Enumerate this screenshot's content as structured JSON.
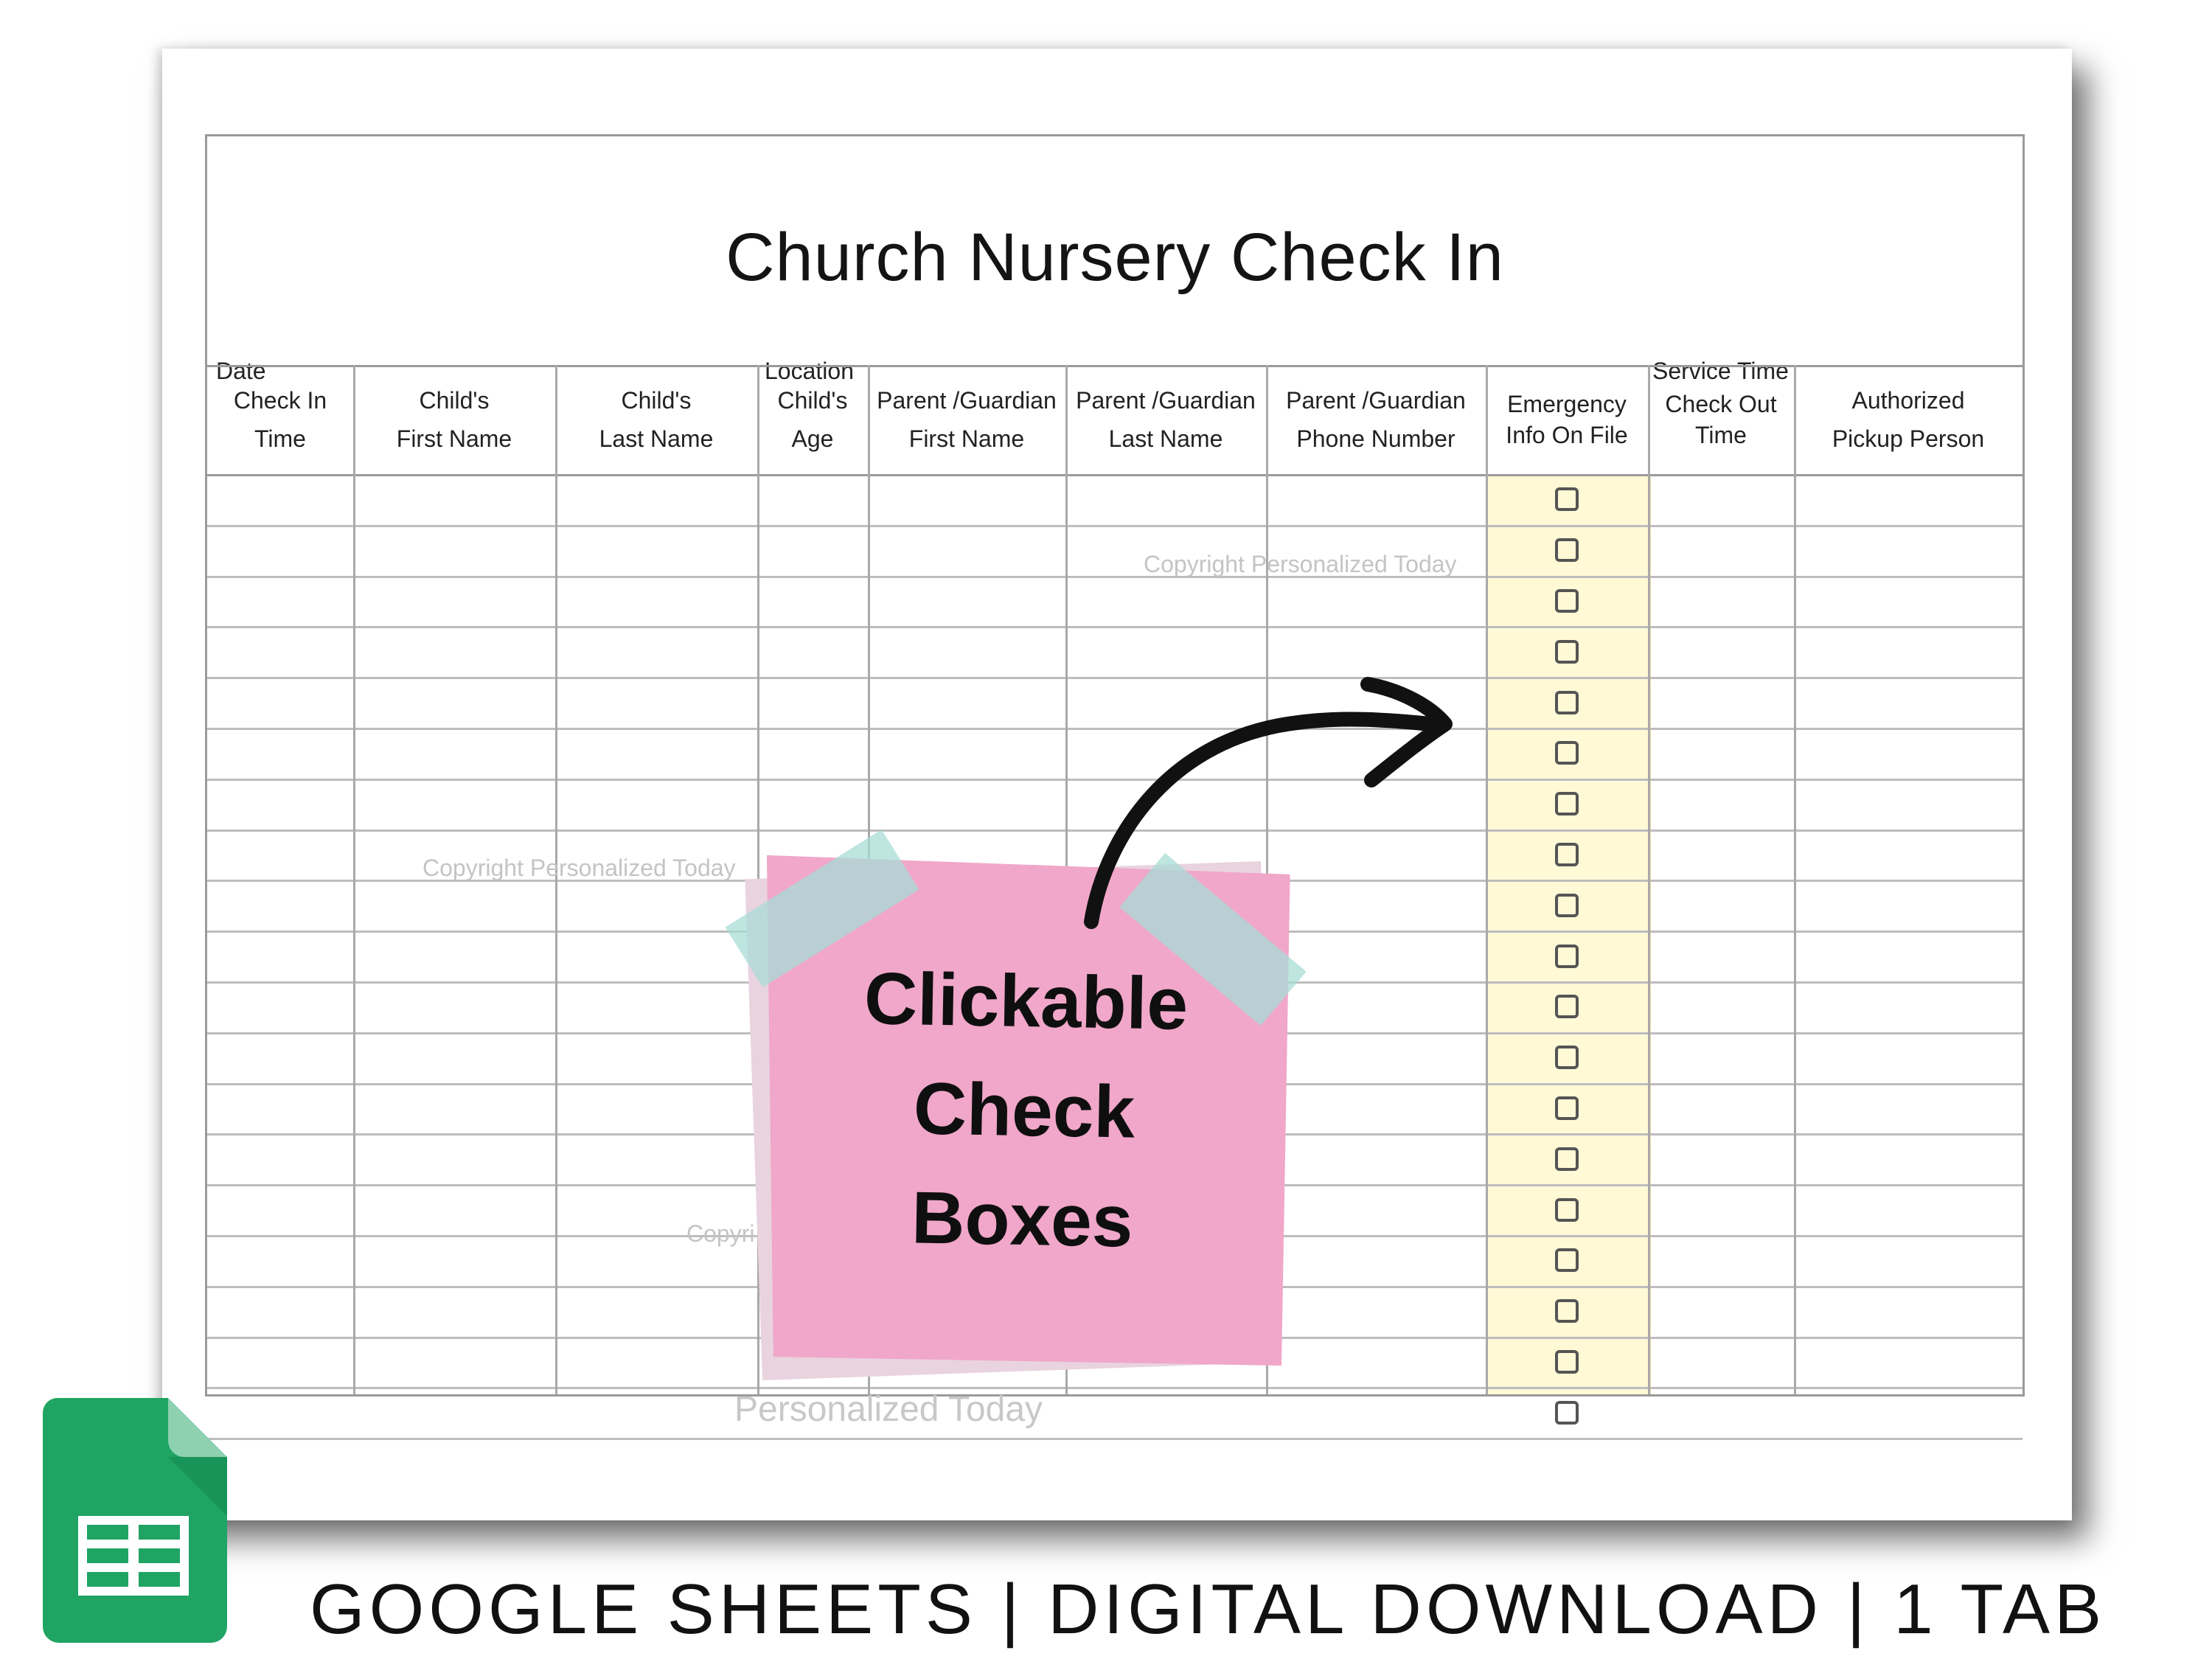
{
  "document": {
    "title": "Church Nursery Check In",
    "meta": {
      "date_label": "Date",
      "location_label": "Location",
      "service_time_label": "Service Time"
    },
    "columns": [
      {
        "line1": "Check In",
        "line2": "Time"
      },
      {
        "line1": "Child's",
        "line2": "First Name"
      },
      {
        "line1": "Child's",
        "line2": "Last Name"
      },
      {
        "line1": "Child's",
        "line2": "Age"
      },
      {
        "line1": "Parent /Guardian",
        "line2": "First Name"
      },
      {
        "line1": "Parent /Guardian",
        "line2": "Last Name"
      },
      {
        "line1": "Parent /Guardian",
        "line2": "Phone Number"
      },
      {
        "line1": "Emergency",
        "line2": "Info On File"
      },
      {
        "line1": "Check Out",
        "line2": "Time"
      },
      {
        "line1": "Authorized",
        "line2": "Pickup Person"
      }
    ],
    "row_count": 19,
    "checkbox_column": 7,
    "highlight_color": "#fff9d6"
  },
  "watermarks": {
    "w1": "Copyright Personalized Today",
    "w2": "Copyright Personalized Today",
    "w3": "Copyri",
    "w4": "Personalized Today"
  },
  "sticky_note": {
    "line1": "Clickable",
    "line2": "Check",
    "line3": "Boxes",
    "color": "#f0a7c9"
  },
  "logo": {
    "icon": "google-sheets-icon",
    "color": "#1fa463"
  },
  "footer": {
    "text": "GOOGLE SHEETS | DIGITAL DOWNLOAD | 1 TAB"
  }
}
